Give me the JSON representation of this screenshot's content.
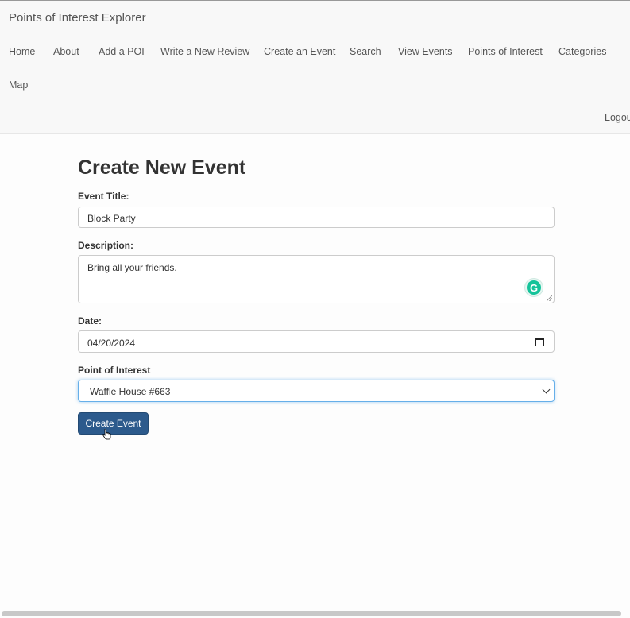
{
  "navbar": {
    "brand": "Points of Interest Explorer",
    "links": [
      "Home",
      "About",
      "Add a POI",
      "Write a New Review",
      "Create an Event",
      "Search",
      "View Events",
      "Points of Interest",
      "Categories",
      "Map"
    ],
    "logout": "Logout"
  },
  "form": {
    "heading": "Create New Event",
    "title_label": "Event Title:",
    "title_value": "Block Party",
    "description_label": "Description:",
    "description_value": "Bring all your friends.",
    "date_label": "Date:",
    "date_value": "04/20/2024",
    "poi_label": "Point of Interest",
    "poi_selected": "Waffle House #663",
    "submit_label": "Create Event"
  },
  "icons": {
    "grammarly": "grammarly-icon",
    "calendar": "calendar-icon",
    "dropdown": "chevron-down-icon"
  },
  "colors": {
    "primary_button": "#2c5a8c",
    "focus_border": "#66afe9",
    "grammarly": "#15c39a"
  }
}
